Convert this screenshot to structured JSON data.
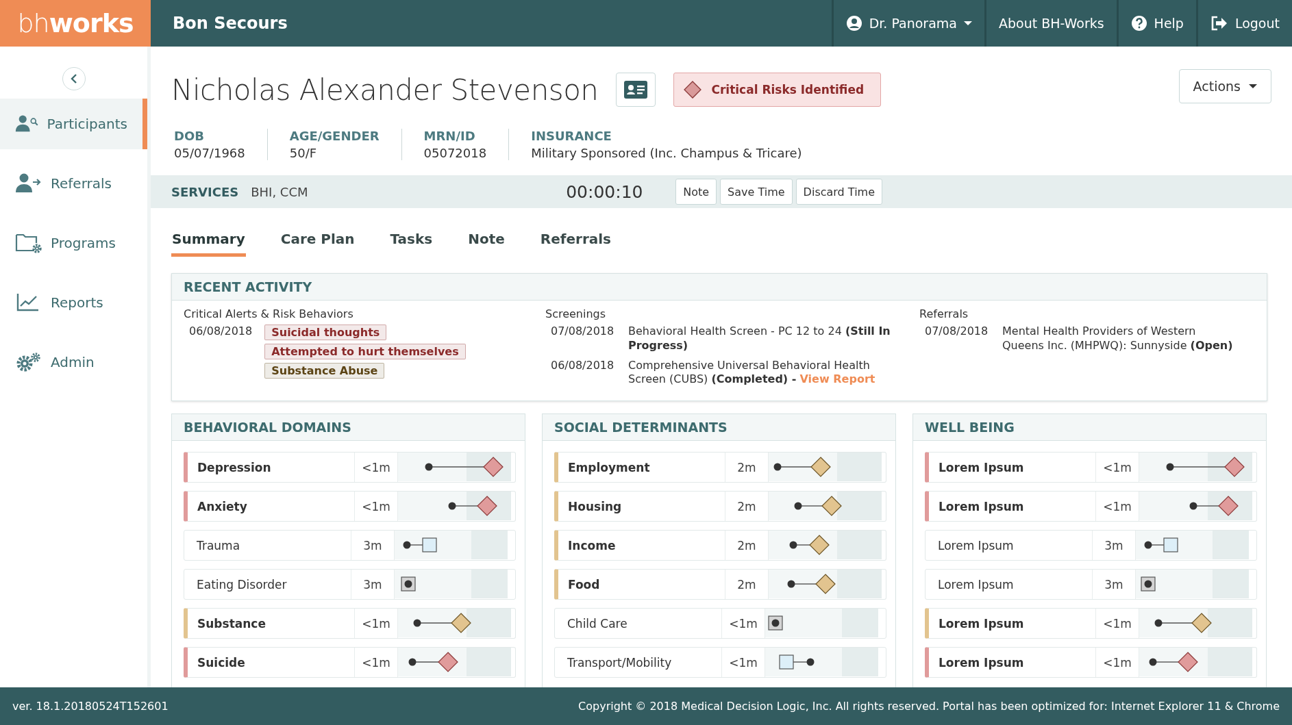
{
  "brand": {
    "logo": "bh**works**",
    "org": "Bon Secours"
  },
  "top_menu": [
    {
      "kind": "user",
      "label": "Dr. Panorama"
    },
    {
      "kind": "link",
      "label": "About BH-Works"
    },
    {
      "kind": "help",
      "label": "Help"
    },
    {
      "kind": "logout",
      "label": "Logout"
    }
  ],
  "sidebar": {
    "items": [
      {
        "kind": "participants",
        "label": "Participants",
        "selected": true
      },
      {
        "kind": "referrals",
        "label": "Referrals",
        "selected": false
      },
      {
        "kind": "programs",
        "label": "Programs",
        "selected": false
      },
      {
        "kind": "reports",
        "label": "Reports",
        "selected": false
      },
      {
        "kind": "admin",
        "label": "Admin",
        "selected": false
      }
    ]
  },
  "patient": {
    "name": "Nicholas Alexander Stevenson",
    "risk_badge": "Critical Risks Identified",
    "actions": "Actions",
    "fields": [
      {
        "label": "DOB",
        "value": "05/07/1968"
      },
      {
        "label": "AGE/GENDER",
        "value": "50/F"
      },
      {
        "label": "MRN/ID",
        "value": "05072018"
      },
      {
        "label": "INSURANCE",
        "value": "Military Sponsored (Inc. Champus & Tricare)"
      }
    ]
  },
  "services": {
    "label": "SERVICES",
    "value": "BHI, CCM",
    "timer": "00:00:10",
    "buttons": [
      "Note",
      "Save Time",
      "Discard Time"
    ]
  },
  "tabs": [
    {
      "label": "Summary",
      "selected": true
    },
    {
      "label": "Care Plan",
      "selected": false
    },
    {
      "label": "Tasks",
      "selected": false
    },
    {
      "label": "Note",
      "selected": false
    },
    {
      "label": "Referrals",
      "selected": false
    }
  ],
  "recent_activity": {
    "title": "RECENT ACTIVITY",
    "alerts": {
      "heading": "Critical Alerts & Risk Behaviors",
      "date": "06/08/2018",
      "tags": [
        {
          "label": "Suicidal thoughts",
          "color": "#8b2a2a"
        },
        {
          "label": "Attempted to hurt themselves",
          "color": "#8b2a2a"
        },
        {
          "label": "Substance Abuse",
          "color": "#5c4415"
        }
      ]
    },
    "screenings": {
      "heading": "Screenings",
      "items": [
        {
          "date": "07/08/2018",
          "text": "Behavioral Health Screen - PC 12 to  24 **(Still In Progress)**"
        },
        {
          "date": "06/08/2018",
          "text": "Comprehensive Universal Behavioral Health Screen (CUBS) **(Completed) -** ",
          "link": "View Report"
        }
      ]
    },
    "referrals": {
      "heading": "Referrals",
      "items": [
        {
          "date": "07/08/2018",
          "text": "Mental Health Providers of Western Queens Inc. (MHPWQ): Sunnyside **(Open)**"
        }
      ]
    }
  },
  "panels": [
    {
      "title": "BEHAVIORAL DOMAINS",
      "rows": [
        {
          "name": "Depression",
          "time": "<1m",
          "color": "#e09b9b",
          "kind": "diamond",
          "level": 0.84,
          "start": {
            "level": 0.27
          }
        },
        {
          "name": "Anxiety",
          "time": "<1m",
          "color": "#e09b9b",
          "kind": "diamond",
          "level": 0.79,
          "start": {
            "level": 0.48
          }
        },
        {
          "name": "Trauma",
          "time": "3m",
          "kind": "square",
          "level": 0.31,
          "start": {
            "level": 0.11
          }
        },
        {
          "name": "Eating Disorder",
          "time": "3m",
          "kind": "dot-box",
          "level": 0.12
        },
        {
          "name": "Substance",
          "time": "<1m",
          "color": "#e2c48f",
          "kind": "diamond",
          "level": 0.56,
          "start": {
            "level": 0.17
          }
        },
        {
          "name": "Suicide",
          "time": "<1m",
          "color": "#e09b9b",
          "kind": "diamond",
          "level": 0.44,
          "start": {
            "level": 0.13
          }
        }
      ]
    },
    {
      "title": "SOCIAL DETERMINANTS",
      "rows": [
        {
          "name": "Employment",
          "time": "2m",
          "color": "#e2c48f",
          "kind": "diamond",
          "level": 0.46,
          "start": {
            "level": 0.08
          }
        },
        {
          "name": "Housing",
          "time": "2m",
          "color": "#e2c48f",
          "kind": "diamond",
          "level": 0.56,
          "start": {
            "level": 0.26
          }
        },
        {
          "name": "Income",
          "time": "2m",
          "color": "#e2c48f",
          "kind": "diamond",
          "level": 0.45,
          "start": {
            "level": 0.22
          }
        },
        {
          "name": "Food",
          "time": "2m",
          "color": "#e2c48f",
          "kind": "diamond",
          "level": 0.5,
          "start": {
            "level": 0.2
          }
        },
        {
          "name": "Child Care",
          "time": "<1m",
          "kind": "dot-box",
          "level": 0.09
        },
        {
          "name": "Transport/Mobility",
          "time": "<1m",
          "kind": "square",
          "level": 0.19,
          "start": {
            "level": 0.4
          }
        }
      ]
    },
    {
      "title": "WELL BEING",
      "rows": [
        {
          "name": "Lorem Ipsum",
          "time": "<1m",
          "color": "#e09b9b",
          "kind": "diamond",
          "level": 0.84,
          "start": {
            "level": 0.27
          }
        },
        {
          "name": "Lorem Ipsum",
          "time": "<1m",
          "color": "#e09b9b",
          "kind": "diamond",
          "level": 0.79,
          "start": {
            "level": 0.48
          }
        },
        {
          "name": "Lorem Ipsum",
          "time": "3m",
          "kind": "square",
          "level": 0.31,
          "start": {
            "level": 0.11
          }
        },
        {
          "name": "Lorem Ipsum",
          "time": "3m",
          "kind": "dot-box",
          "level": 0.11
        },
        {
          "name": "Lorem Ipsum",
          "time": "<1m",
          "color": "#e2c48f",
          "kind": "diamond",
          "level": 0.55,
          "start": {
            "level": 0.17
          }
        },
        {
          "name": "Lorem Ipsum",
          "time": "<1m",
          "color": "#e09b9b",
          "kind": "diamond",
          "level": 0.43,
          "start": {
            "level": 0.12
          }
        }
      ]
    }
  ],
  "footer": {
    "version": "ver. 18.1.20180524T152601",
    "copyright": "Copyright © 2018 Medical Decision Logic, Inc. All rights reserved. Portal has been optimized for: Internet Explorer 11 & Chrome"
  }
}
